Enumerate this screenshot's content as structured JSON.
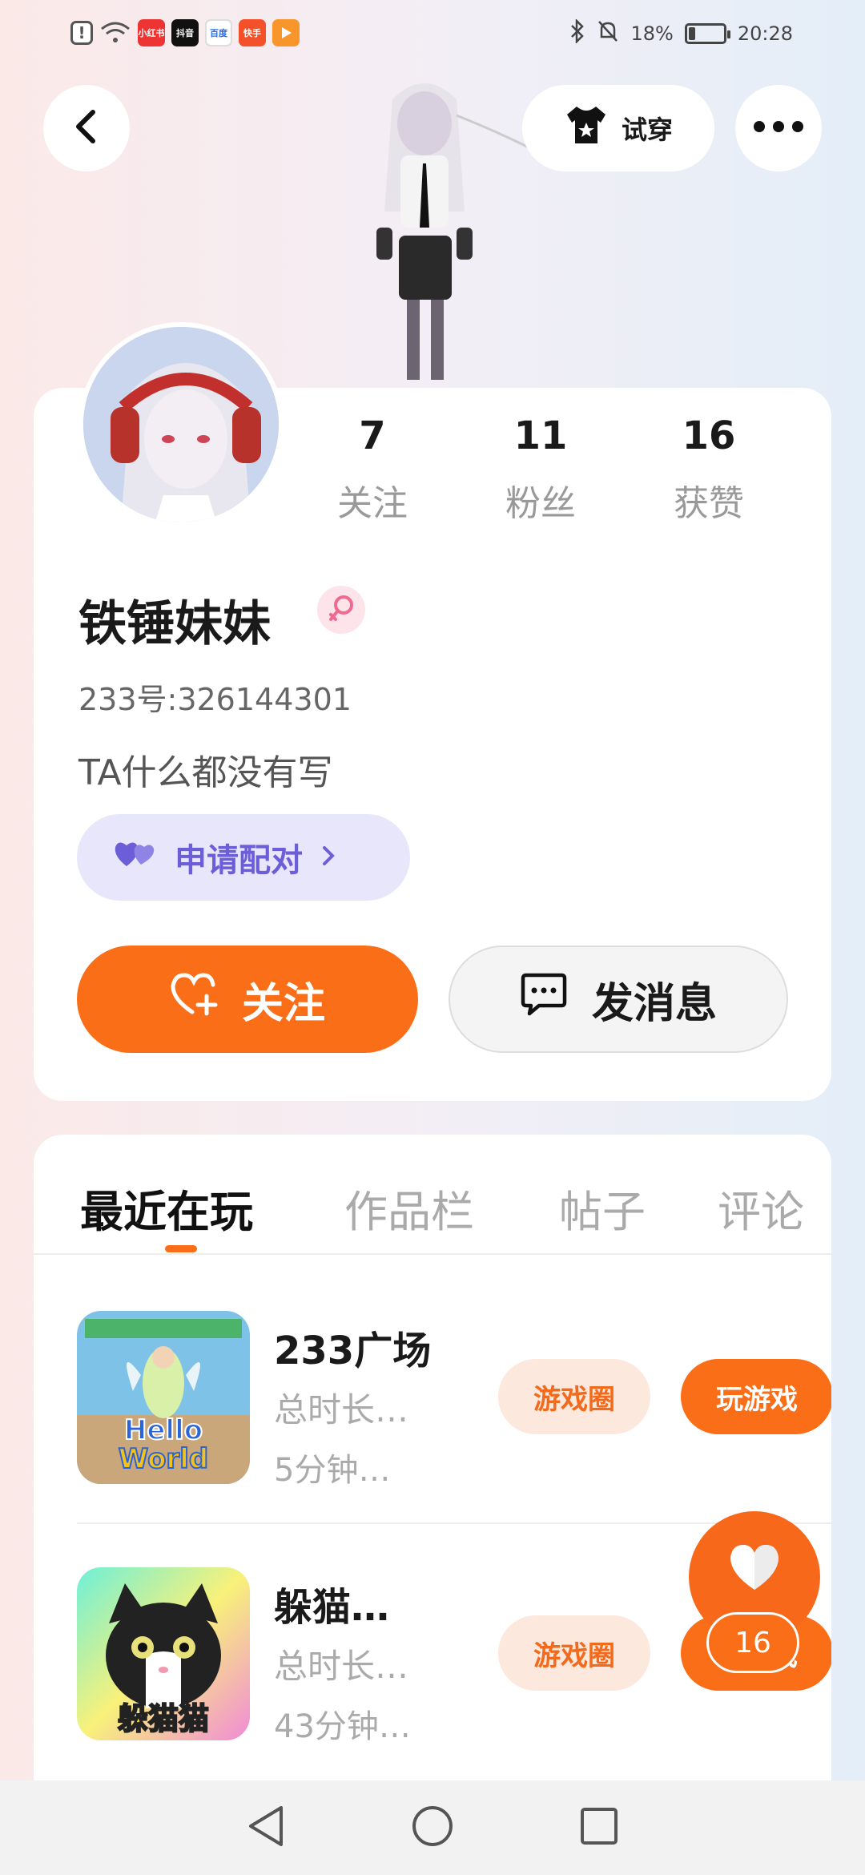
{
  "status_bar": {
    "apps": [
      "!",
      "wifi",
      "小红书",
      "抖音",
      "百度",
      "快手",
      "播放"
    ],
    "battery_text": "18%",
    "battery_level": 0.18,
    "time": "20:28"
  },
  "header": {
    "tryon_label": "试穿"
  },
  "profile": {
    "stats": [
      {
        "value": "7",
        "label": "关注"
      },
      {
        "value": "11",
        "label": "粉丝"
      },
      {
        "value": "16",
        "label": "获赞"
      }
    ],
    "username": "铁锤妹妹",
    "user_id": "233号:326144301",
    "bio": "TA什么都没有写",
    "pair_label": "申请配对",
    "follow_label": "关注",
    "message_label": "发消息"
  },
  "tabs": [
    {
      "label": "最近在玩",
      "active": true
    },
    {
      "label": "作品栏",
      "active": false
    },
    {
      "label": "帖子",
      "active": false
    },
    {
      "label": "评论",
      "active": false
    }
  ],
  "games": [
    {
      "title": "233广场",
      "meta1": "总时长…",
      "meta2": "5分钟…",
      "circle_label": "游戏圈",
      "play_label": "玩游戏",
      "icon_text": "Hello World"
    },
    {
      "title": "躲猫…",
      "meta1": "总时长…",
      "meta2": "43分钟…",
      "circle_label": "游戏圈",
      "play_label": "玩游戏",
      "icon_text": "躲猫猫"
    }
  ],
  "like_fab": {
    "count": "16"
  },
  "colors": {
    "accent": "#fa6e17",
    "pair_purple": "#6c5ed8"
  }
}
